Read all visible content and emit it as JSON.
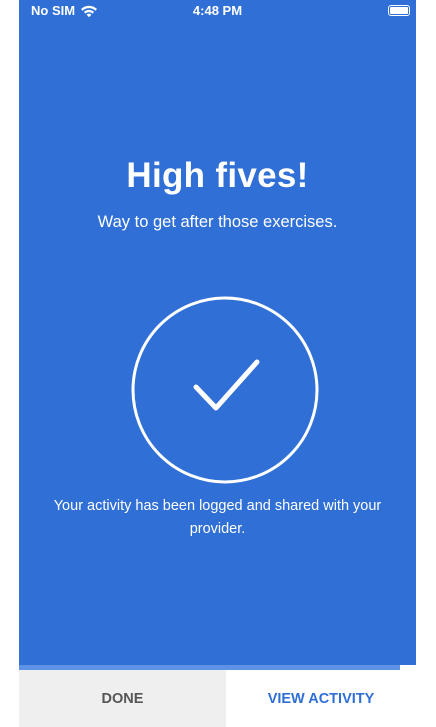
{
  "status_bar": {
    "carrier": "No SIM",
    "time": "4:48 PM",
    "wifi_icon": "wifi-icon",
    "battery_icon": "battery-icon"
  },
  "screen": {
    "headline": "High fives!",
    "subheadline": "Way to get after those exercises.",
    "check_icon": "check-circle-icon",
    "message": "Your activity has been logged and shared with your provider."
  },
  "progress": {
    "fraction": 0.96
  },
  "actions": {
    "done_label": "DONE",
    "view_activity_label": "VIEW ACTIVITY"
  },
  "colors": {
    "background": "#2f6fd6",
    "accent": "#2f6fd6",
    "progress_fill": "#5d92e6",
    "done_bg": "#efefef",
    "done_text": "#555555"
  }
}
